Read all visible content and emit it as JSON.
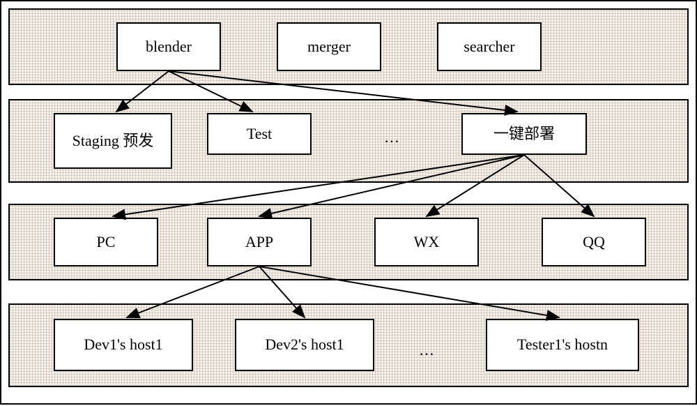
{
  "row1": {
    "blender": "blender",
    "merger": "merger",
    "searcher": "searcher"
  },
  "row2": {
    "staging": "Staging 预发",
    "test": "Test",
    "ellipsis": "…",
    "deploy": "一键部署"
  },
  "row3": {
    "pc": "PC",
    "app": "APP",
    "wx": "WX",
    "qq": "QQ"
  },
  "row4": {
    "dev1": "Dev1's host1",
    "dev2": "Dev2's host1",
    "ellipsis": "…",
    "tester": "Tester1's hostn"
  }
}
